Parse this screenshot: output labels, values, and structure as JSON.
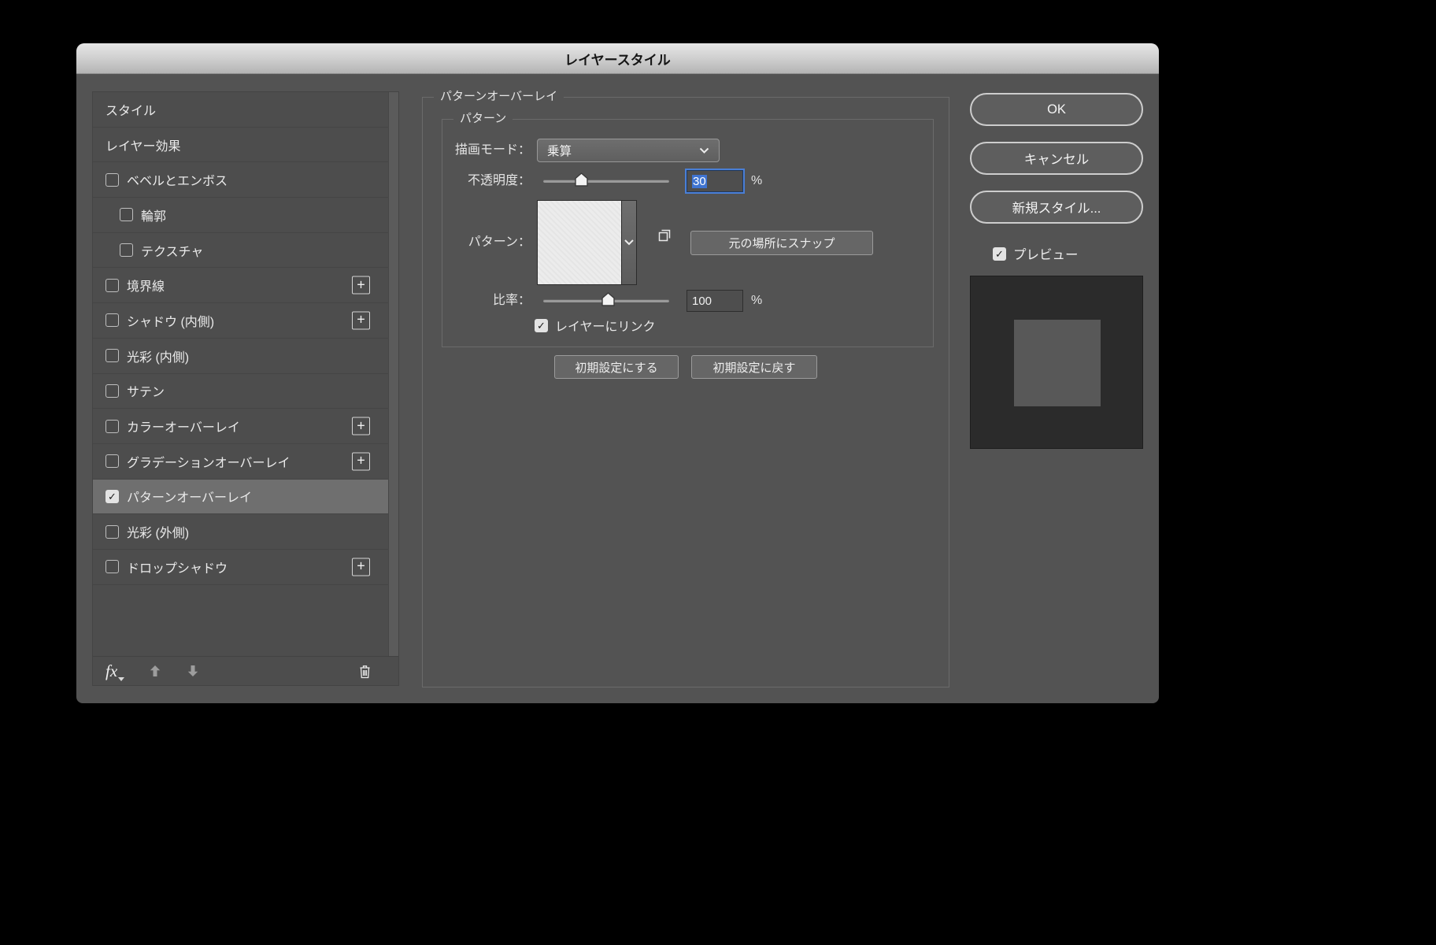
{
  "window": {
    "title": "レイヤースタイル"
  },
  "sidebar": {
    "items": [
      {
        "label": "スタイル",
        "checkbox": false,
        "checked": false,
        "indent": false,
        "plus": false,
        "selected": false
      },
      {
        "label": "レイヤー効果",
        "checkbox": false,
        "checked": false,
        "indent": false,
        "plus": false,
        "selected": false
      },
      {
        "label": "ベベルとエンボス",
        "checkbox": true,
        "checked": false,
        "indent": false,
        "plus": false,
        "selected": false
      },
      {
        "label": "輪郭",
        "checkbox": true,
        "checked": false,
        "indent": true,
        "plus": false,
        "selected": false
      },
      {
        "label": "テクスチャ",
        "checkbox": true,
        "checked": false,
        "indent": true,
        "plus": false,
        "selected": false
      },
      {
        "label": "境界線",
        "checkbox": true,
        "checked": false,
        "indent": false,
        "plus": true,
        "selected": false
      },
      {
        "label": "シャドウ (内側)",
        "checkbox": true,
        "checked": false,
        "indent": false,
        "plus": true,
        "selected": false
      },
      {
        "label": "光彩 (内側)",
        "checkbox": true,
        "checked": false,
        "indent": false,
        "plus": false,
        "selected": false
      },
      {
        "label": "サテン",
        "checkbox": true,
        "checked": false,
        "indent": false,
        "plus": false,
        "selected": false
      },
      {
        "label": "カラーオーバーレイ",
        "checkbox": true,
        "checked": false,
        "indent": false,
        "plus": true,
        "selected": false
      },
      {
        "label": "グラデーションオーバーレイ",
        "checkbox": true,
        "checked": false,
        "indent": false,
        "plus": true,
        "selected": false
      },
      {
        "label": "パターンオーバーレイ",
        "checkbox": true,
        "checked": true,
        "indent": false,
        "plus": false,
        "selected": true
      },
      {
        "label": "光彩 (外側)",
        "checkbox": true,
        "checked": false,
        "indent": false,
        "plus": false,
        "selected": false
      },
      {
        "label": "ドロップシャドウ",
        "checkbox": true,
        "checked": false,
        "indent": false,
        "plus": true,
        "selected": false
      }
    ],
    "toolbar": {
      "fx_label": "fx",
      "up_icon": "arrow-up",
      "down_icon": "arrow-down",
      "trash_icon": "trash"
    }
  },
  "main": {
    "group_title": "パターンオーバーレイ",
    "inner_group_title": "パターン",
    "blend_mode": {
      "label": "描画モード：",
      "value": "乗算"
    },
    "opacity": {
      "label": "不透明度：",
      "value": "30",
      "unit": "%",
      "slider_fraction": 0.3,
      "focused": true
    },
    "pattern": {
      "label": "パターン：",
      "snap_button": "元の場所にスナップ",
      "new_pattern_icon": "new-pattern"
    },
    "scale": {
      "label": "比率：",
      "value": "100",
      "unit": "%",
      "slider_fraction": 0.51
    },
    "link_checkbox": {
      "label": "レイヤーにリンク",
      "checked": true
    },
    "make_default_button": "初期設定にする",
    "reset_default_button": "初期設定に戻す"
  },
  "actions": {
    "ok": "OK",
    "cancel": "キャンセル",
    "new_style": "新規スタイル...",
    "preview_label": "プレビュー",
    "preview_checked": true
  },
  "colors": {
    "dialog_bg": "#535353",
    "selected_row": "#6f6f6f",
    "focus_ring": "#4a7fd6",
    "selection_bg": "#3f74d1",
    "preview_bg": "#2b2b2b",
    "preview_square": "#585858"
  }
}
